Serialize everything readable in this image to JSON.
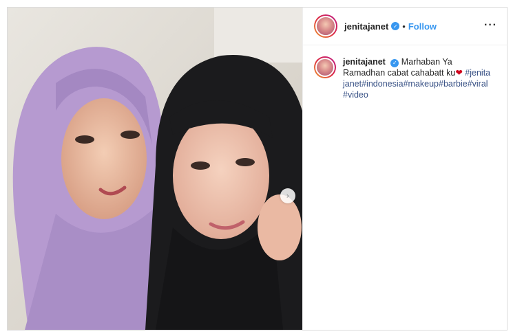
{
  "header": {
    "username": "jenitajanet",
    "dot": "•",
    "follow_label": "Follow",
    "more_label": "···",
    "avatar_icon": "profile-avatar-icon",
    "verified_icon": "verified-badge-icon"
  },
  "caption": {
    "username": "jenitajanet",
    "text": "Marhaban Ya Ramadhan cabat cahabatt ku",
    "heart": "❤",
    "hashtags": "#jenitajanet#indonesia#makeup#barbie#viral#video"
  },
  "carousel": {
    "next_icon": "chevron-right-icon",
    "next_glyph": "›"
  },
  "colors": {
    "link": "#3897f0",
    "hashtag": "#385185",
    "verified": "#3897f0"
  }
}
